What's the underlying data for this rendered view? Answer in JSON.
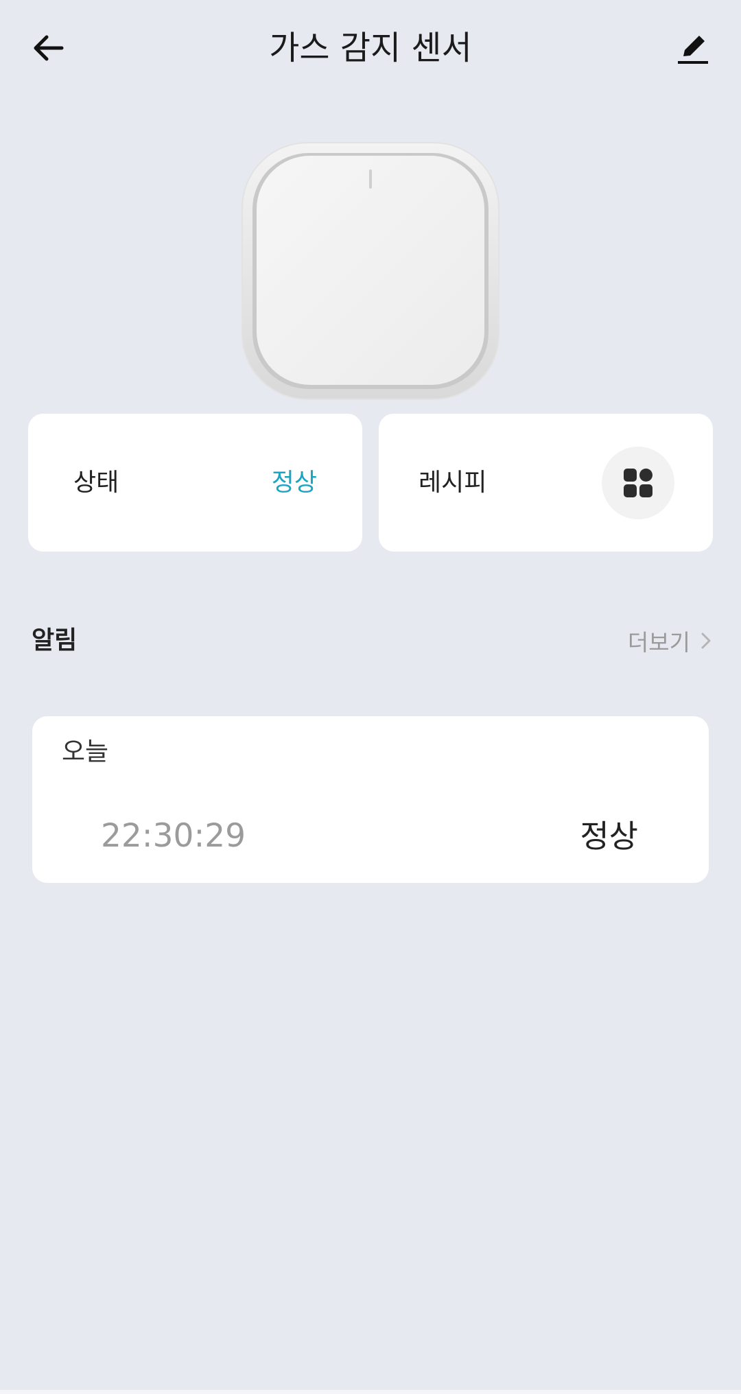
{
  "header": {
    "title": "가스 감지 센서",
    "back_icon": "arrow-left-icon",
    "edit_icon": "pencil-icon"
  },
  "device": {
    "image": "gas-sensor-device"
  },
  "status_card": {
    "label": "상태",
    "value": "정상",
    "value_color": "#1aa6c2"
  },
  "recipe_card": {
    "label": "레시피",
    "icon": "grid-apps-icon"
  },
  "alerts": {
    "title": "알림",
    "more_label": "더보기",
    "more_icon": "chevron-right-icon",
    "items": [
      {
        "date": "오늘",
        "time": "22:30:29",
        "state": "정상"
      }
    ]
  },
  "colors": {
    "background": "#e6e9f0",
    "card": "#ffffff",
    "accent": "#1aa6c2"
  }
}
